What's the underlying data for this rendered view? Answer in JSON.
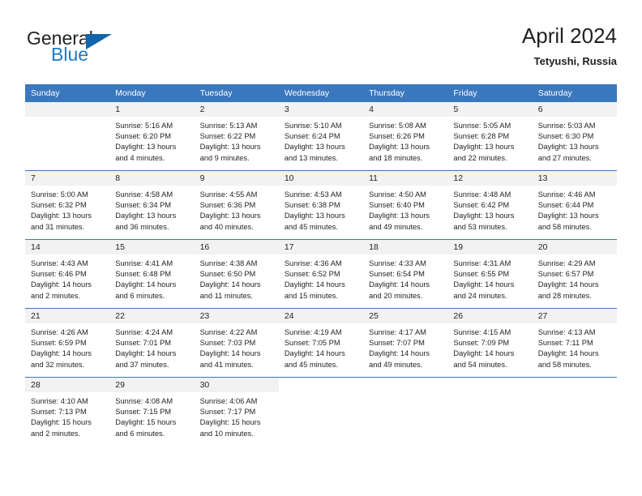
{
  "brand": {
    "line1": "General",
    "line2": "Blue",
    "logo_icon": "triangle-logo-icon",
    "colors": {
      "blue": "#1f7ac4",
      "triangle": "#1065ab",
      "dark": "#231f20"
    }
  },
  "header": {
    "title": "April 2024",
    "location": "Tetyushi, Russia"
  },
  "calendar": {
    "header_bg": "#3a77bd",
    "daynum_bg": "#f2f2f2",
    "weekdays": [
      "Sunday",
      "Monday",
      "Tuesday",
      "Wednesday",
      "Thursday",
      "Friday",
      "Saturday"
    ],
    "weeks": [
      [
        {
          "day": "",
          "empty": true,
          "sunrise": "",
          "sunset": "",
          "daylight1": "",
          "daylight2": ""
        },
        {
          "day": "1",
          "sunrise": "Sunrise: 5:16 AM",
          "sunset": "Sunset: 6:20 PM",
          "daylight1": "Daylight: 13 hours",
          "daylight2": "and 4 minutes."
        },
        {
          "day": "2",
          "sunrise": "Sunrise: 5:13 AM",
          "sunset": "Sunset: 6:22 PM",
          "daylight1": "Daylight: 13 hours",
          "daylight2": "and 9 minutes."
        },
        {
          "day": "3",
          "sunrise": "Sunrise: 5:10 AM",
          "sunset": "Sunset: 6:24 PM",
          "daylight1": "Daylight: 13 hours",
          "daylight2": "and 13 minutes."
        },
        {
          "day": "4",
          "sunrise": "Sunrise: 5:08 AM",
          "sunset": "Sunset: 6:26 PM",
          "daylight1": "Daylight: 13 hours",
          "daylight2": "and 18 minutes."
        },
        {
          "day": "5",
          "sunrise": "Sunrise: 5:05 AM",
          "sunset": "Sunset: 6:28 PM",
          "daylight1": "Daylight: 13 hours",
          "daylight2": "and 22 minutes."
        },
        {
          "day": "6",
          "sunrise": "Sunrise: 5:03 AM",
          "sunset": "Sunset: 6:30 PM",
          "daylight1": "Daylight: 13 hours",
          "daylight2": "and 27 minutes."
        }
      ],
      [
        {
          "day": "7",
          "sunrise": "Sunrise: 5:00 AM",
          "sunset": "Sunset: 6:32 PM",
          "daylight1": "Daylight: 13 hours",
          "daylight2": "and 31 minutes."
        },
        {
          "day": "8",
          "sunrise": "Sunrise: 4:58 AM",
          "sunset": "Sunset: 6:34 PM",
          "daylight1": "Daylight: 13 hours",
          "daylight2": "and 36 minutes."
        },
        {
          "day": "9",
          "sunrise": "Sunrise: 4:55 AM",
          "sunset": "Sunset: 6:36 PM",
          "daylight1": "Daylight: 13 hours",
          "daylight2": "and 40 minutes."
        },
        {
          "day": "10",
          "sunrise": "Sunrise: 4:53 AM",
          "sunset": "Sunset: 6:38 PM",
          "daylight1": "Daylight: 13 hours",
          "daylight2": "and 45 minutes."
        },
        {
          "day": "11",
          "sunrise": "Sunrise: 4:50 AM",
          "sunset": "Sunset: 6:40 PM",
          "daylight1": "Daylight: 13 hours",
          "daylight2": "and 49 minutes."
        },
        {
          "day": "12",
          "sunrise": "Sunrise: 4:48 AM",
          "sunset": "Sunset: 6:42 PM",
          "daylight1": "Daylight: 13 hours",
          "daylight2": "and 53 minutes."
        },
        {
          "day": "13",
          "sunrise": "Sunrise: 4:46 AM",
          "sunset": "Sunset: 6:44 PM",
          "daylight1": "Daylight: 13 hours",
          "daylight2": "and 58 minutes."
        }
      ],
      [
        {
          "day": "14",
          "sunrise": "Sunrise: 4:43 AM",
          "sunset": "Sunset: 6:46 PM",
          "daylight1": "Daylight: 14 hours",
          "daylight2": "and 2 minutes."
        },
        {
          "day": "15",
          "sunrise": "Sunrise: 4:41 AM",
          "sunset": "Sunset: 6:48 PM",
          "daylight1": "Daylight: 14 hours",
          "daylight2": "and 6 minutes."
        },
        {
          "day": "16",
          "sunrise": "Sunrise: 4:38 AM",
          "sunset": "Sunset: 6:50 PM",
          "daylight1": "Daylight: 14 hours",
          "daylight2": "and 11 minutes."
        },
        {
          "day": "17",
          "sunrise": "Sunrise: 4:36 AM",
          "sunset": "Sunset: 6:52 PM",
          "daylight1": "Daylight: 14 hours",
          "daylight2": "and 15 minutes."
        },
        {
          "day": "18",
          "sunrise": "Sunrise: 4:33 AM",
          "sunset": "Sunset: 6:54 PM",
          "daylight1": "Daylight: 14 hours",
          "daylight2": "and 20 minutes."
        },
        {
          "day": "19",
          "sunrise": "Sunrise: 4:31 AM",
          "sunset": "Sunset: 6:55 PM",
          "daylight1": "Daylight: 14 hours",
          "daylight2": "and 24 minutes."
        },
        {
          "day": "20",
          "sunrise": "Sunrise: 4:29 AM",
          "sunset": "Sunset: 6:57 PM",
          "daylight1": "Daylight: 14 hours",
          "daylight2": "and 28 minutes."
        }
      ],
      [
        {
          "day": "21",
          "sunrise": "Sunrise: 4:26 AM",
          "sunset": "Sunset: 6:59 PM",
          "daylight1": "Daylight: 14 hours",
          "daylight2": "and 32 minutes."
        },
        {
          "day": "22",
          "sunrise": "Sunrise: 4:24 AM",
          "sunset": "Sunset: 7:01 PM",
          "daylight1": "Daylight: 14 hours",
          "daylight2": "and 37 minutes."
        },
        {
          "day": "23",
          "sunrise": "Sunrise: 4:22 AM",
          "sunset": "Sunset: 7:03 PM",
          "daylight1": "Daylight: 14 hours",
          "daylight2": "and 41 minutes."
        },
        {
          "day": "24",
          "sunrise": "Sunrise: 4:19 AM",
          "sunset": "Sunset: 7:05 PM",
          "daylight1": "Daylight: 14 hours",
          "daylight2": "and 45 minutes."
        },
        {
          "day": "25",
          "sunrise": "Sunrise: 4:17 AM",
          "sunset": "Sunset: 7:07 PM",
          "daylight1": "Daylight: 14 hours",
          "daylight2": "and 49 minutes."
        },
        {
          "day": "26",
          "sunrise": "Sunrise: 4:15 AM",
          "sunset": "Sunset: 7:09 PM",
          "daylight1": "Daylight: 14 hours",
          "daylight2": "and 54 minutes."
        },
        {
          "day": "27",
          "sunrise": "Sunrise: 4:13 AM",
          "sunset": "Sunset: 7:11 PM",
          "daylight1": "Daylight: 14 hours",
          "daylight2": "and 58 minutes."
        }
      ],
      [
        {
          "day": "28",
          "sunrise": "Sunrise: 4:10 AM",
          "sunset": "Sunset: 7:13 PM",
          "daylight1": "Daylight: 15 hours",
          "daylight2": "and 2 minutes."
        },
        {
          "day": "29",
          "sunrise": "Sunrise: 4:08 AM",
          "sunset": "Sunset: 7:15 PM",
          "daylight1": "Daylight: 15 hours",
          "daylight2": "and 6 minutes."
        },
        {
          "day": "30",
          "sunrise": "Sunrise: 4:06 AM",
          "sunset": "Sunset: 7:17 PM",
          "daylight1": "Daylight: 15 hours",
          "daylight2": "and 10 minutes."
        },
        {
          "day": "",
          "blank": true,
          "sunrise": "",
          "sunset": "",
          "daylight1": "",
          "daylight2": ""
        },
        {
          "day": "",
          "blank": true,
          "sunrise": "",
          "sunset": "",
          "daylight1": "",
          "daylight2": ""
        },
        {
          "day": "",
          "blank": true,
          "sunrise": "",
          "sunset": "",
          "daylight1": "",
          "daylight2": ""
        },
        {
          "day": "",
          "blank": true,
          "sunrise": "",
          "sunset": "",
          "daylight1": "",
          "daylight2": ""
        }
      ]
    ]
  }
}
